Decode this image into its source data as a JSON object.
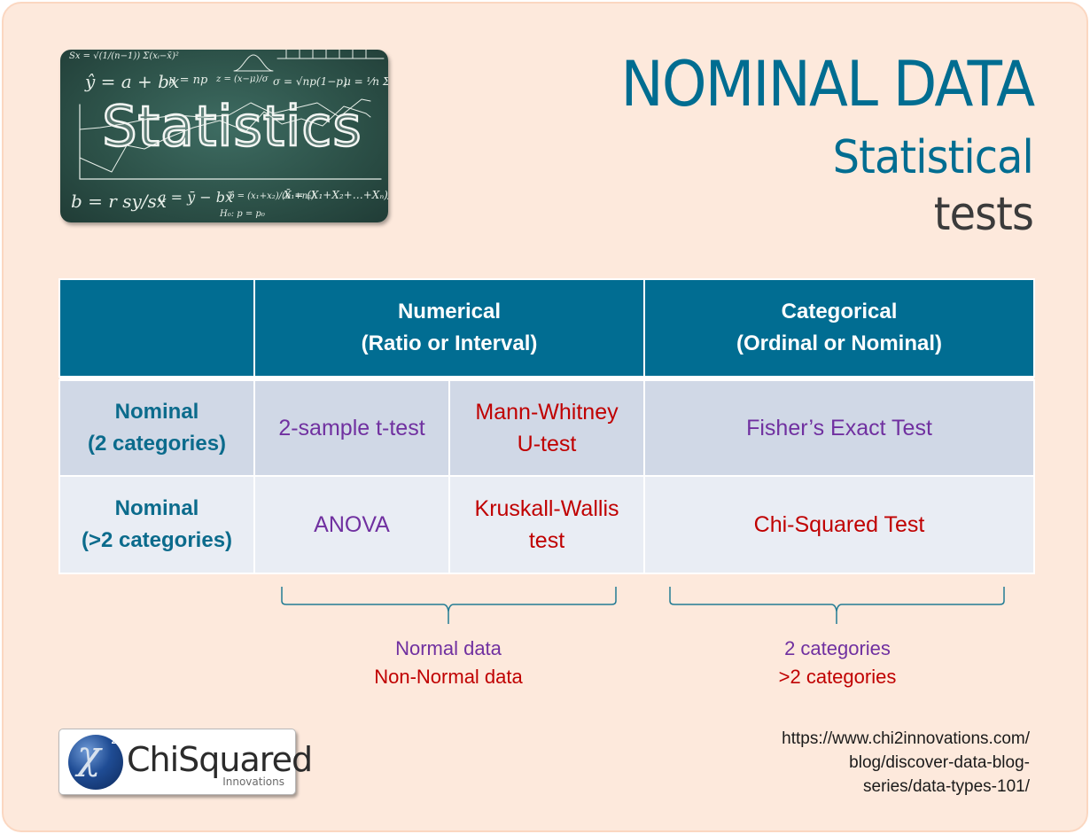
{
  "header": {
    "title": "NOMINAL DATA",
    "subtitle_line1": "Statistical",
    "subtitle_line2": "tests"
  },
  "image": {
    "label": "Statistics",
    "formulas": {
      "top": "ŷ = a + bx   μ = np   z = (x−μ)/σ   σ = √np(1−p)   μ = 1/n Σxᵢ",
      "bottom": "b = r sy/sx   a = ȳ − b x̄   p̂ = (x₁+x₂)/(n₁+n₂)   X̄ = (X₁+X₂+X₃+…+Xₙ)/n"
    }
  },
  "table": {
    "columns": [
      {
        "line1": "",
        "line2": ""
      },
      {
        "line1": "Numerical",
        "line2": "(Ratio or Interval)"
      },
      {
        "line1": "Categorical",
        "line2": "(Ordinal or Nominal)"
      }
    ],
    "rows": [
      {
        "label_line1": "Nominal",
        "label_line2": "(2 categories)",
        "parametric": "2-sample t-test",
        "nonparametric_line1": "Mann-Whitney",
        "nonparametric_line2": "U-test",
        "categorical": "Fisher’s Exact Test"
      },
      {
        "label_line1": "Nominal",
        "label_line2": "(>2 categories)",
        "parametric": "ANOVA",
        "nonparametric_line1": "Kruskall-Wallis",
        "nonparametric_line2": "test",
        "categorical": "Chi-Squared Test"
      }
    ]
  },
  "legend": {
    "numerical": {
      "purple": "Normal data",
      "red": "Non-Normal data"
    },
    "categorical": {
      "purple": "2 categories",
      "red": ">2 categories"
    }
  },
  "logo": {
    "symbol": "χ",
    "superscript": "2",
    "name": "ChiSquared",
    "tagline": "Innovations"
  },
  "source_url": {
    "line1": "https://www.chi2innovations.com/",
    "line2": "blog/discover-data-blog-",
    "line3": "series/data-types-101/"
  },
  "colors": {
    "background": "#fde9dc",
    "accent_blue": "#006d91",
    "header_fill": "#016d92",
    "row1_fill": "#d0d8e6",
    "row2_fill": "#e9edf4",
    "purple": "#7030a0",
    "red": "#c00000"
  }
}
